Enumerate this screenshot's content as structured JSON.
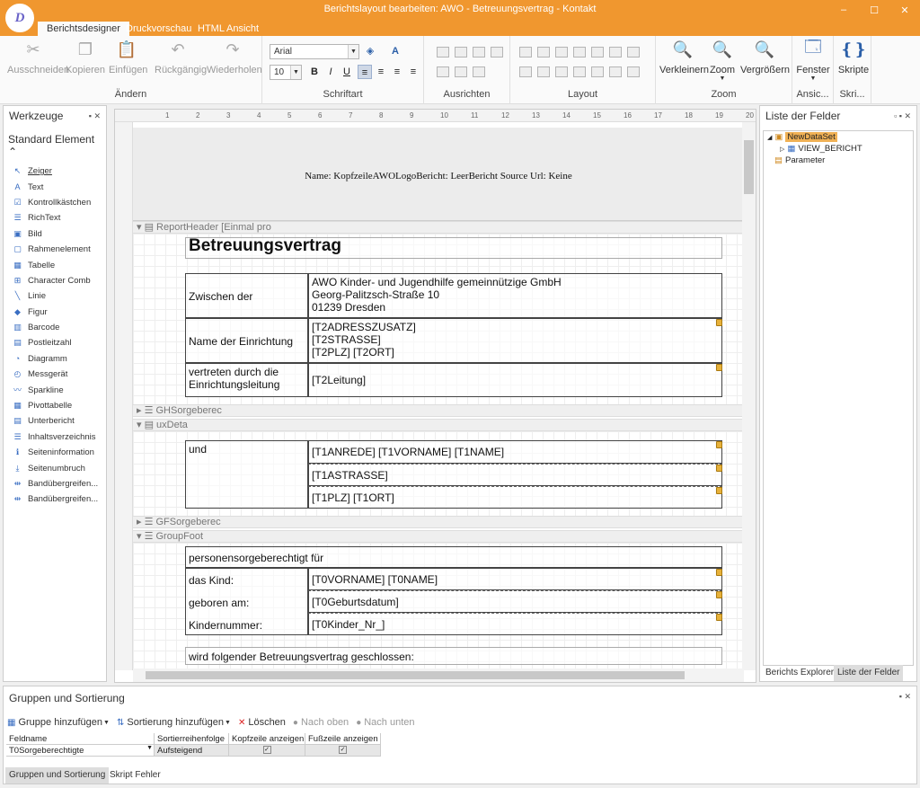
{
  "window": {
    "title": "Berichtslayout bearbeiten: AWO - Betreuungsvertrag - Kontakt",
    "logo_text": "D",
    "controls": [
      "–",
      "☐",
      "✕"
    ]
  },
  "ribbon": {
    "tabs": [
      "Berichtsdesigner",
      "Druckvorschau",
      "HTML Ansicht"
    ],
    "groups": {
      "edit": {
        "label": "Ändern",
        "buttons": [
          "Ausschneiden",
          "Kopieren",
          "Einfügen",
          "Rückgängig",
          "Wiederholen"
        ]
      },
      "font": {
        "label": "Schriftart",
        "font_name": "Arial",
        "font_size": "10",
        "bold": "B",
        "italic": "I",
        "underline": "U"
      },
      "align": {
        "label": "Ausrichten"
      },
      "layout": {
        "label": "Layout"
      },
      "zoom": {
        "label": "Zoom",
        "buttons": [
          "Verkleinern",
          "Zoom",
          "Vergrößern"
        ]
      },
      "view": {
        "label": "Ansic...",
        "button": "Fenster"
      },
      "scripts": {
        "label": "Skri...",
        "button": "Skripte"
      }
    }
  },
  "toolbox": {
    "title": "Werkzeuge",
    "section": "Standard Element",
    "items": [
      "Zeiger",
      "Text",
      "Kontrollkästchen",
      "RichText",
      "Bild",
      "Rahmenelement",
      "Tabelle",
      "Character Comb",
      "Linie",
      "Figur",
      "Barcode",
      "Postleitzahl",
      "Diagramm",
      "Messgerät",
      "Sparkline",
      "Pivottabelle",
      "Unterbericht",
      "Inhaltsverzeichnis",
      "Seiteninformation",
      "Seitenumbruch",
      "Bandübergreifen...",
      "Bandübergreifen..."
    ]
  },
  "ruler": {
    "top": [
      "1",
      "2",
      "3",
      "4",
      "5",
      "6",
      "7",
      "8",
      "9",
      "10",
      "11",
      "12",
      "13",
      "14",
      "15",
      "16",
      "17",
      "18",
      "19",
      "20"
    ]
  },
  "design": {
    "page_header_text": "Name: KopfzeileAWOLogoBericht: LeerBericht Source Url: Keine",
    "bands": {
      "report_header": "ReportHeader [Einmal pro",
      "group_header": "GHSorgeberec",
      "detail": "uxDeta",
      "group_footer_1": "GFSorgeberec",
      "group_footer_2": "GroupFoot"
    },
    "report": {
      "title": "Betreuungsvertrag",
      "rows": [
        {
          "label": "Zwischen der",
          "value": [
            "AWO Kinder- und Jugendhilfe gemeinnützige GmbH",
            "Georg-Palitzsch-Straße 10",
            "01239 Dresden"
          ]
        },
        {
          "label": "Name der Einrichtung",
          "value": [
            "[T2ADRESSZUSATZ]",
            "[T2STRASSE]",
            "[T2PLZ] [T2ORT]"
          ]
        },
        {
          "label": "vertreten durch die Einrichtungsleitung",
          "value": [
            "[T2Leitung]"
          ]
        }
      ]
    },
    "detail": {
      "label": "und",
      "values": [
        "[T1ANREDE] [T1VORNAME] [T1NAME]",
        "[T1ASTRASSE]",
        "[T1PLZ] [T1ORT]"
      ]
    },
    "footer": {
      "intro": "personensorgeberechtigt für",
      "rows": [
        {
          "label": "das Kind:",
          "value": "[T0VORNAME] [T0NAME]"
        },
        {
          "label": "geboren am:",
          "value": "[T0Geburtsdatum]"
        },
        {
          "label": "Kindernummer:",
          "value": "[T0Kinder_Nr_]"
        }
      ],
      "closing": "wird folgender Betreuungsvertrag geschlossen:"
    }
  },
  "fields": {
    "title": "Liste der Felder",
    "tree": [
      "NewDataSet",
      "VIEW_BERICHT",
      "Parameter"
    ],
    "tabs": [
      "Berichts Explorer",
      "Liste der Felder"
    ]
  },
  "groups": {
    "title": "Gruppen und Sortierung",
    "toolbar": [
      "Gruppe hinzufügen",
      "Sortierung hinzufügen",
      "Löschen",
      "Nach oben",
      "Nach unten"
    ],
    "columns": [
      "Feldname",
      "Sortierreihenfolge",
      "Kopfzeile anzeigen",
      "Fußzeile anzeigen"
    ],
    "rows": [
      {
        "field": "T0Sorgeberechtigte",
        "order": "Aufsteigend",
        "header": "✓",
        "footer": "✓"
      }
    ],
    "tabs": [
      "Gruppen und Sortierung",
      "Skript Fehler"
    ]
  },
  "icons": {
    "accent": "#f0972f",
    "marker": "#e7b13a"
  }
}
